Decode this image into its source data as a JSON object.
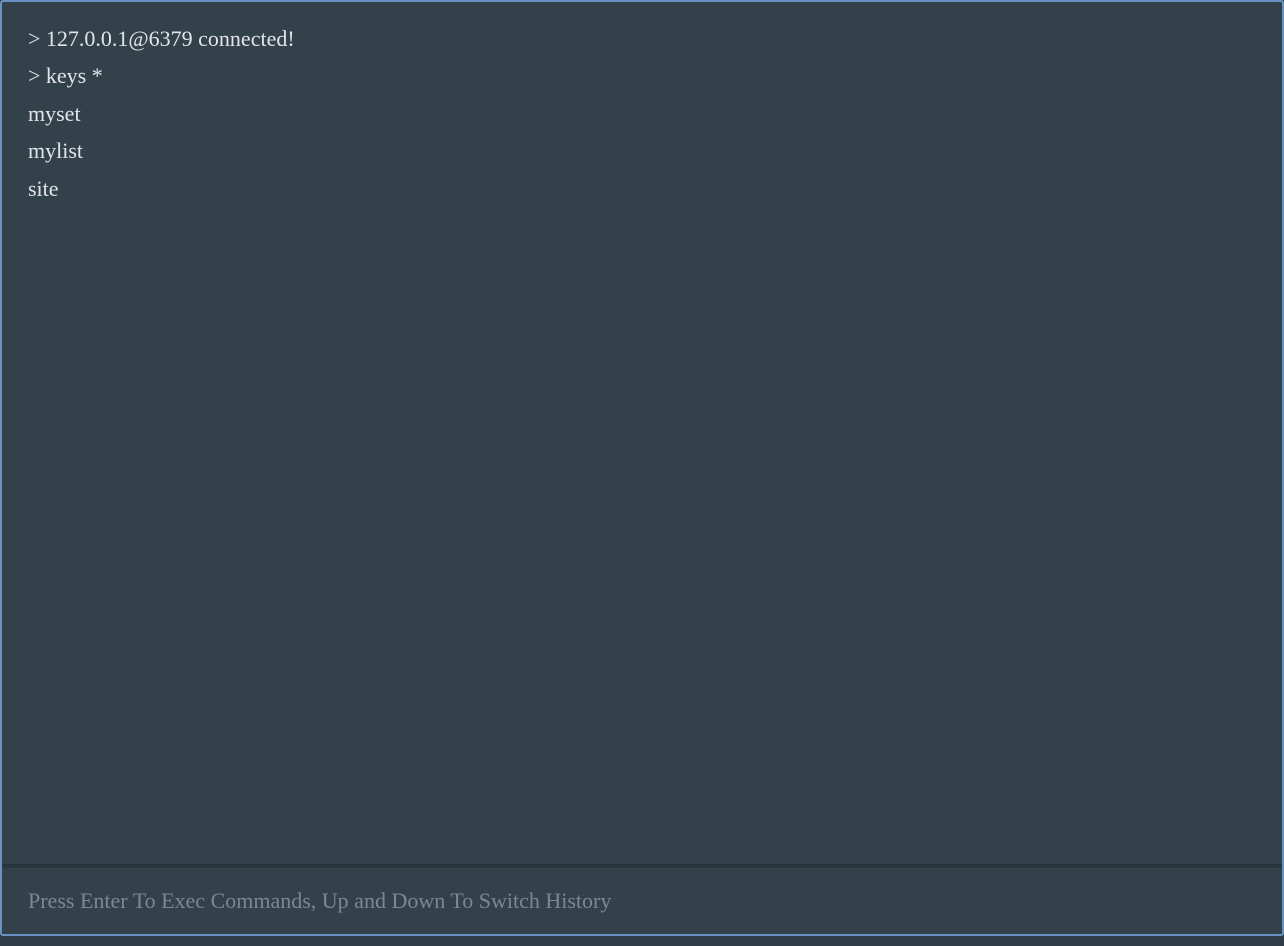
{
  "prompt": ">",
  "output": {
    "lines": [
      {
        "text": "> 127.0.0.1@6379 connected!"
      },
      {
        "text": "> keys *"
      },
      {
        "text": "myset"
      },
      {
        "text": "mylist"
      },
      {
        "text": "site"
      }
    ]
  },
  "input": {
    "value": "",
    "placeholder": "Press Enter To Exec Commands, Up and Down To Switch History"
  }
}
